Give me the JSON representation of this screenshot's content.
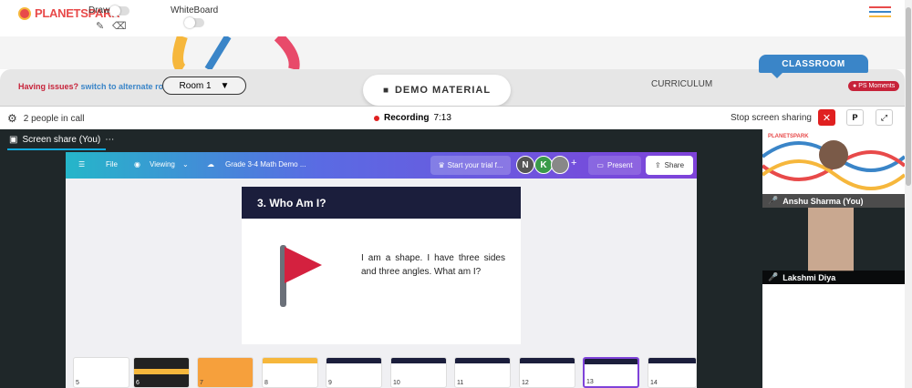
{
  "brand": {
    "logo_text": "PLANETSPARK"
  },
  "top": {
    "draw_label": "Draw",
    "whiteboard_label": "WhiteBoard"
  },
  "room_bar": {
    "issues_text": "Having issues?",
    "alternate_link": "switch to alternate room",
    "room_label": "Room 1",
    "demo_material": "DEMO MATERIAL",
    "curriculum": "CURRICULUM",
    "classroom": "CLASSROOM",
    "ps_moments": "PS Moments"
  },
  "call": {
    "people": "2 people in call",
    "recording_label": "Recording",
    "recording_time": "7:13",
    "stop_share": "Stop screen sharing",
    "p_button": "P"
  },
  "screen_share": {
    "label": "Screen share (You)",
    "canva": {
      "file": "File",
      "viewing": "Viewing",
      "doc_title": "Grade 3-4 Math Demo ...",
      "trial": "Start your trial f...",
      "avatars": [
        "N",
        "K"
      ],
      "present": "Present",
      "share": "Share"
    },
    "slide": {
      "heading": "3. Who Am I?",
      "text": "I am a shape. I have three sides and three angles. What am I?"
    },
    "thumbnails": [
      "5",
      "6",
      "7",
      "8",
      "9",
      "10",
      "11",
      "12",
      "13",
      "14"
    ],
    "active_thumbnail": "13"
  },
  "participants": [
    {
      "name": "Anshu Sharma (You)"
    },
    {
      "name": "Lakshmi Diya"
    }
  ],
  "colors": {
    "accent": "#3a85c8",
    "danger": "#e02020",
    "canva_purple": "#7f42d9",
    "brand_red": "#e84a4a"
  }
}
